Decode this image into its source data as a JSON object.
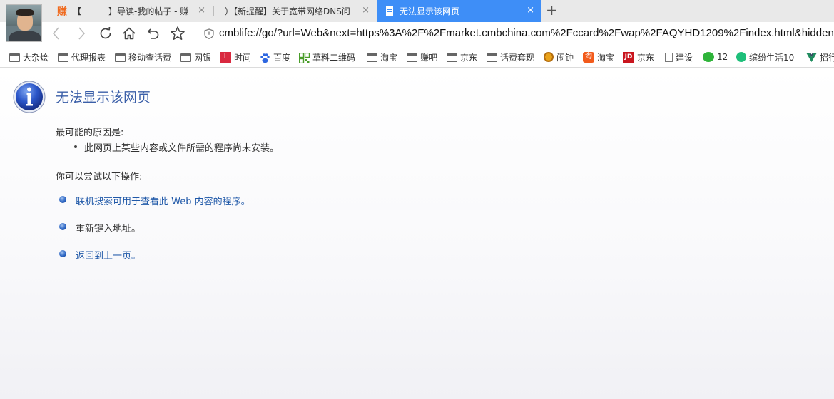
{
  "tabs": [
    {
      "prefix": "赚",
      "pre_text": "【",
      "dimmed": "",
      "title": "】导读-我的帖子 - 赚",
      "close": "×"
    },
    {
      "prefix": "",
      "pre_text": "",
      "dimmed": "",
      "title": "）【新提醒】关于宽带网络DNS问",
      "close": "×"
    },
    {
      "prefix": "",
      "pre_text": "",
      "dimmed": "",
      "title": "无法显示该网页",
      "close": "×"
    }
  ],
  "new_tab_symbol": "+",
  "address_bar": {
    "url": "cmblife://go/?url=Web&next=https%3A%2F%2Fmarket.cmbchina.com%2Fccard%2Fwap%2FAQYHD1209%2Findex.html&hiddenN"
  },
  "bookmarks": [
    {
      "label": "大杂烩",
      "icon": "folder-icon"
    },
    {
      "label": "代理报表",
      "icon": "folder-icon"
    },
    {
      "label": "移动查话费",
      "icon": "folder-icon"
    },
    {
      "label": "网银",
      "icon": "folder-icon"
    },
    {
      "label": "时间",
      "icon": "calendar-icon"
    },
    {
      "label": "百度",
      "icon": "baidu-icon"
    },
    {
      "label": "草料二维码",
      "icon": "qrcode-icon"
    },
    {
      "label": "淘宝",
      "icon": "folder-icon"
    },
    {
      "label": "赚吧",
      "icon": "folder-icon"
    },
    {
      "label": "京东",
      "icon": "folder-icon"
    },
    {
      "label": "话费套现",
      "icon": "folder-icon"
    },
    {
      "label": "闹钟",
      "icon": "alarm-icon"
    },
    {
      "label": "淘宝",
      "icon": "taobao-icon"
    },
    {
      "label": "京东",
      "icon": "jd-icon"
    },
    {
      "label": "建设",
      "icon": "doc-icon"
    },
    {
      "label": "12",
      "icon": "wechat-icon"
    },
    {
      "label": "缤纷生活10",
      "icon": "app-icon"
    },
    {
      "label": "招行",
      "icon": "vue-icon"
    }
  ],
  "error_page": {
    "title": "无法显示该网页",
    "reason_heading": "最可能的原因是:",
    "reasons": [
      "此网页上某些内容或文件所需的程序尚未安装。"
    ],
    "actions_heading": "你可以尝试以下操作:",
    "actions": [
      {
        "text": "联机搜索可用于查看此 Web 内容的程序。",
        "link": true
      },
      {
        "text": "重新键入地址。",
        "link": false
      },
      {
        "text": "返回到上一页。",
        "link": true
      }
    ]
  },
  "colors": {
    "active_tab": "#3e8ef7",
    "link": "#1f58a8",
    "title": "#3b5fa8"
  }
}
